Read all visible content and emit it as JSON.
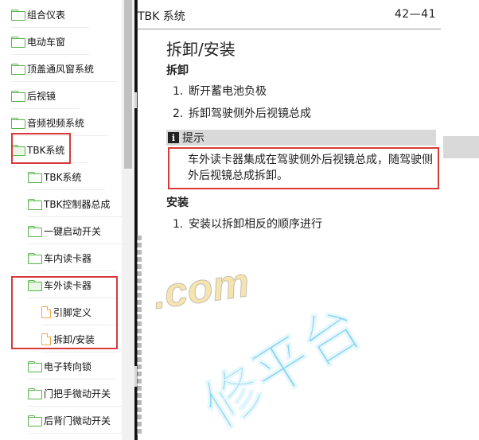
{
  "tree": {
    "items": [
      {
        "label": "组合仪表",
        "icon": "folder-icon",
        "level": 0
      },
      {
        "label": "电动车窗",
        "icon": "folder-icon",
        "level": 0
      },
      {
        "label": "顶盖通风窗系统",
        "icon": "folder-icon",
        "level": 0
      },
      {
        "label": "后视镜",
        "icon": "folder-icon",
        "level": 0
      },
      {
        "label": "音频视频系统",
        "icon": "folder-icon",
        "level": 0
      },
      {
        "label": "TBK系统",
        "icon": "folder-open-icon",
        "level": 0
      },
      {
        "label": "TBK系统",
        "icon": "folder-icon",
        "level": 1
      },
      {
        "label": "TBK控制器总成",
        "icon": "folder-icon",
        "level": 1
      },
      {
        "label": "一键启动开关",
        "icon": "folder-icon",
        "level": 1
      },
      {
        "label": "车内读卡器",
        "icon": "folder-icon",
        "level": 1
      },
      {
        "label": "车外读卡器",
        "icon": "folder-open-icon",
        "level": 1
      },
      {
        "label": "引脚定义",
        "icon": "document-icon",
        "level": 2
      },
      {
        "label": "拆卸/安装",
        "icon": "document-icon",
        "level": 2
      },
      {
        "label": "电子转向锁",
        "icon": "folder-icon",
        "level": 1
      },
      {
        "label": "门把手微动开关",
        "icon": "folder-icon",
        "level": 1
      },
      {
        "label": "后背门微动开关",
        "icon": "folder-icon",
        "level": 1
      }
    ]
  },
  "doc": {
    "header_title": "TBK 系统",
    "page_number": "42—41",
    "section_title": "拆卸/安装",
    "removal": {
      "heading": "拆卸",
      "steps": [
        {
          "num": "1.",
          "text": "断开蓄电池负极"
        },
        {
          "num": "2.",
          "text": "拆卸驾驶侧外后视镜总成"
        }
      ]
    },
    "tip": {
      "icon_letter": "i",
      "label": "提示",
      "text": "车外读卡器集成在驾驶侧外后视镜总成，随驾驶侧外后视镜总成拆卸。"
    },
    "install": {
      "heading": "安装",
      "steps": [
        {
          "num": "1.",
          "text": "安装以拆卸相反的顺序进行"
        }
      ]
    }
  },
  "watermark": {
    "latin": ".com",
    "chinese": "修平台"
  },
  "colors": {
    "highlight": "#d83a3a",
    "folder": "#58b44a",
    "document": "#f0a64d",
    "tip_bar": "#d9d9d9"
  }
}
